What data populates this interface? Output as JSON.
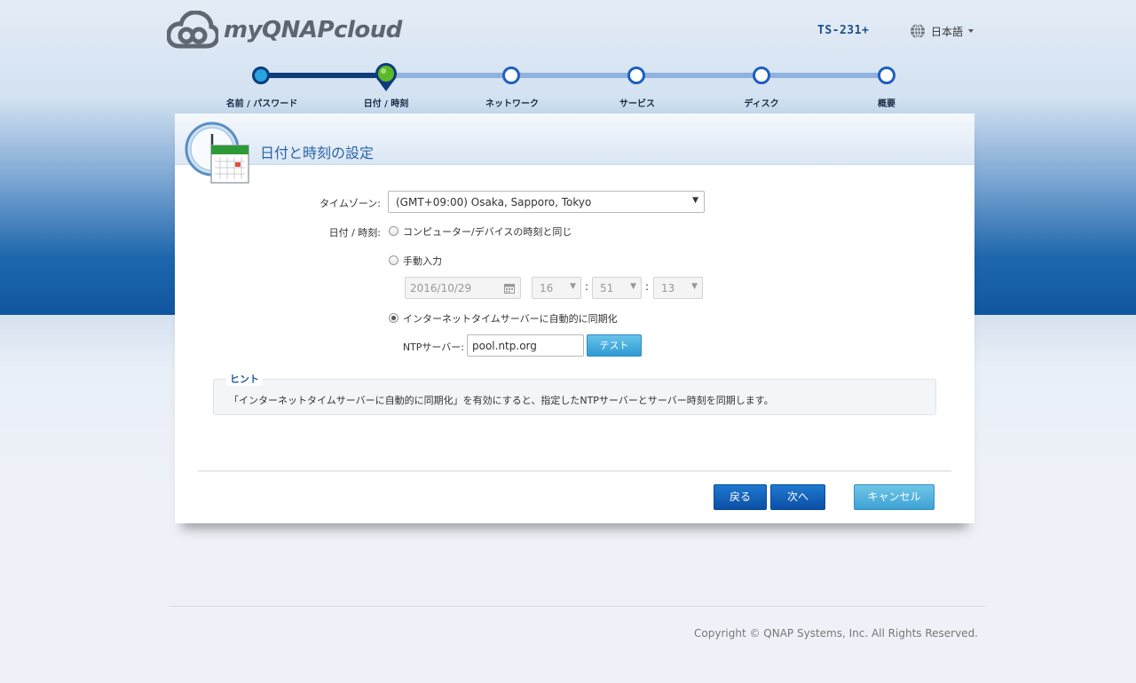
{
  "header": {
    "logo_text": "myQNAPcloud",
    "device_name": "TS-231+",
    "language": "日本語"
  },
  "steps": [
    {
      "label": "名前 / パスワード",
      "state": "done"
    },
    {
      "label": "日付 / 時刻",
      "state": "current"
    },
    {
      "label": "ネットワーク",
      "state": "todo"
    },
    {
      "label": "サービス",
      "state": "todo"
    },
    {
      "label": "ディスク",
      "state": "todo"
    },
    {
      "label": "概要",
      "state": "todo"
    }
  ],
  "panel": {
    "title": "日付と時刻の設定",
    "timezone_label": "タイムゾーン:",
    "timezone_value": "(GMT+09:00) Osaka, Sapporo, Tokyo",
    "datetime_label": "日付 / 時刻:",
    "option_sync_computer": "コンピューター/デバイスの時刻と同じ",
    "option_manual": "手動入力",
    "manual_date": "2016/10/29",
    "manual_hour": "16",
    "manual_minute": "51",
    "manual_second": "13",
    "option_internet": "インターネットタイムサーバーに自動的に同期化",
    "selected_option": "internet",
    "ntp_label": "NTPサーバー:",
    "ntp_value": "pool.ntp.org",
    "test_button": "テスト",
    "hint_title": "ヒント",
    "hint_text": "「インターネットタイムサーバーに自動的に同期化」を有効にすると、指定したNTPサーバーとサーバー時刻を同期します。"
  },
  "buttons": {
    "back": "戻る",
    "next": "次へ",
    "cancel": "キャンセル"
  },
  "footer": {
    "copyright": "Copyright © QNAP Systems, Inc. All Rights Reserved."
  },
  "colors": {
    "accent_blue": "#0b4fa5",
    "step_done": "#0e3b7c",
    "step_todo": "#8fb2df",
    "current_step": "#5cb82a"
  }
}
